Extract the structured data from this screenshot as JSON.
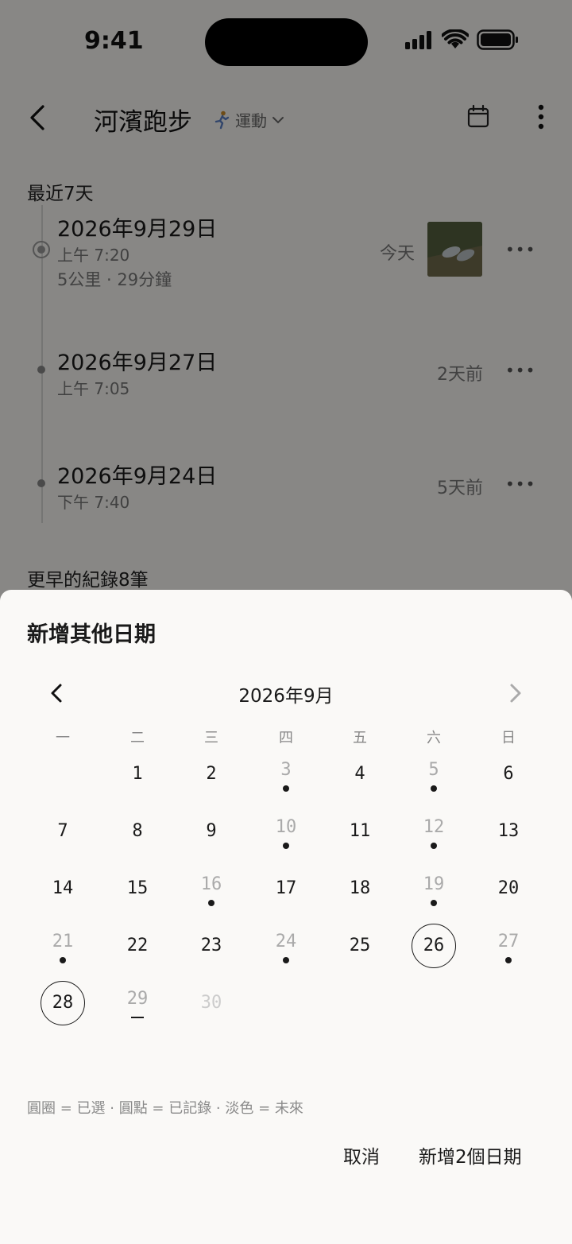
{
  "status": {
    "time": "9:41"
  },
  "header": {
    "title": "河濱跑步",
    "category_icon": "runner",
    "category": "運動",
    "calendar_icon": "calendar-icon",
    "more_icon": "vertical-dots-icon"
  },
  "recent": {
    "section_title": "最近7天",
    "entries": [
      {
        "date": "2026年9月29日",
        "time": "上午 7:20",
        "meta": "5公里 · 29分鐘",
        "relative": "今天",
        "has_photo": true
      },
      {
        "date": "2026年9月27日",
        "time": "上午 7:05",
        "relative": "2天前"
      },
      {
        "date": "2026年9月24日",
        "time": "下午 7:40",
        "relative": "5天前"
      }
    ]
  },
  "earlier": {
    "section_title": "更早的紀錄8筆"
  },
  "sheet": {
    "title": "新增其他日期",
    "month_label": "2026年9月",
    "weekdays": [
      "一",
      "二",
      "三",
      "四",
      "五",
      "六",
      "日"
    ],
    "legend": "圓圈 = 已選 · 圓點 = 已記錄 · 淡色 = 未來",
    "cancel_label": "取消",
    "confirm_label": "新增2個日期"
  },
  "calendar": {
    "first_weekday_index": 1,
    "days_in_month": 30,
    "recorded_days": [
      3,
      5,
      10,
      12,
      16,
      19,
      21,
      24,
      27
    ],
    "selected_days": [
      26,
      28
    ],
    "today": 29,
    "future_days": [
      30
    ]
  },
  "colors": {
    "accent": "#1a1a1a",
    "muted": "#aaaaaa",
    "future": "#cccccc",
    "sheet_bg": "#faf9f7"
  }
}
